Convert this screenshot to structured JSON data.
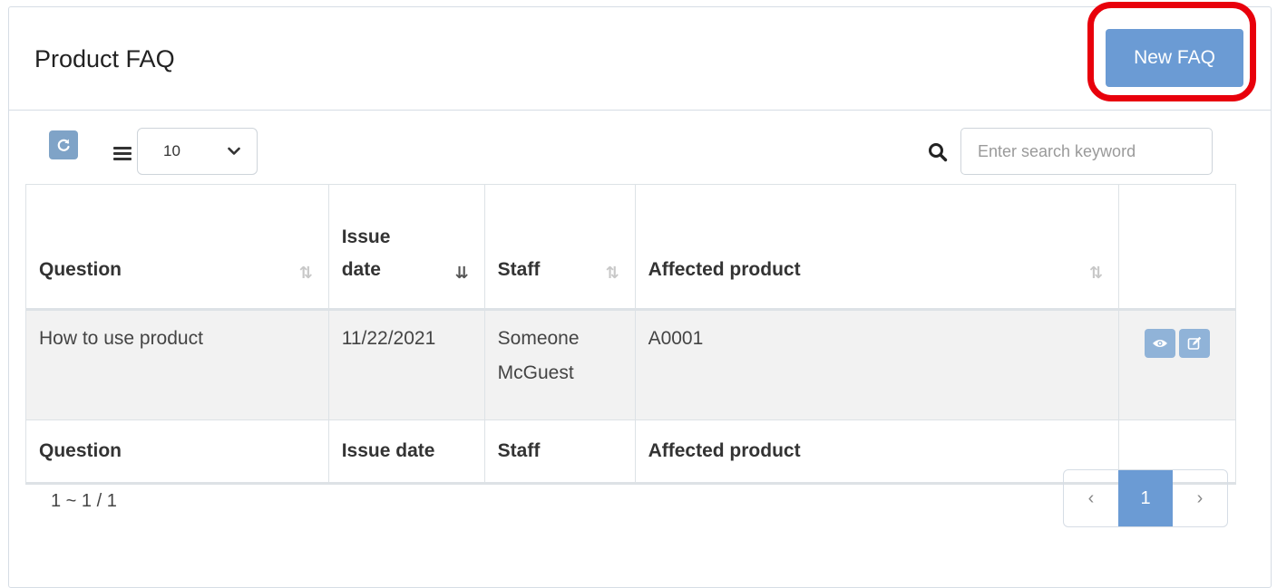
{
  "panel": {
    "title": "Product FAQ",
    "new_button_label": "New FAQ"
  },
  "toolbar": {
    "page_size": "10",
    "search_placeholder": "Enter search keyword"
  },
  "table": {
    "headers": {
      "question": "Question",
      "issue_date_line1": "Issue",
      "issue_date_line2": "date",
      "staff": "Staff",
      "affected_product": "Affected product"
    },
    "rows": [
      {
        "question": "How to use product",
        "issue_date": "11/22/2021",
        "staff_line1": "Someone",
        "staff_line2": "McGuest",
        "affected_product": "A0001"
      }
    ],
    "footer": {
      "question": "Question",
      "issue_date": "Issue date",
      "staff": "Staff",
      "affected_product": "Affected product"
    }
  },
  "pagination": {
    "range_text": "1 ~ 1 / 1",
    "prev": "‹",
    "current_page": "1",
    "next": "›"
  },
  "colors": {
    "primary": "#6b9bd4",
    "highlight": "#e8000b"
  },
  "icons": {
    "refresh": "refresh-icon",
    "list": "list-icon",
    "search": "search-icon",
    "view": "eye-icon",
    "edit": "edit-icon"
  }
}
